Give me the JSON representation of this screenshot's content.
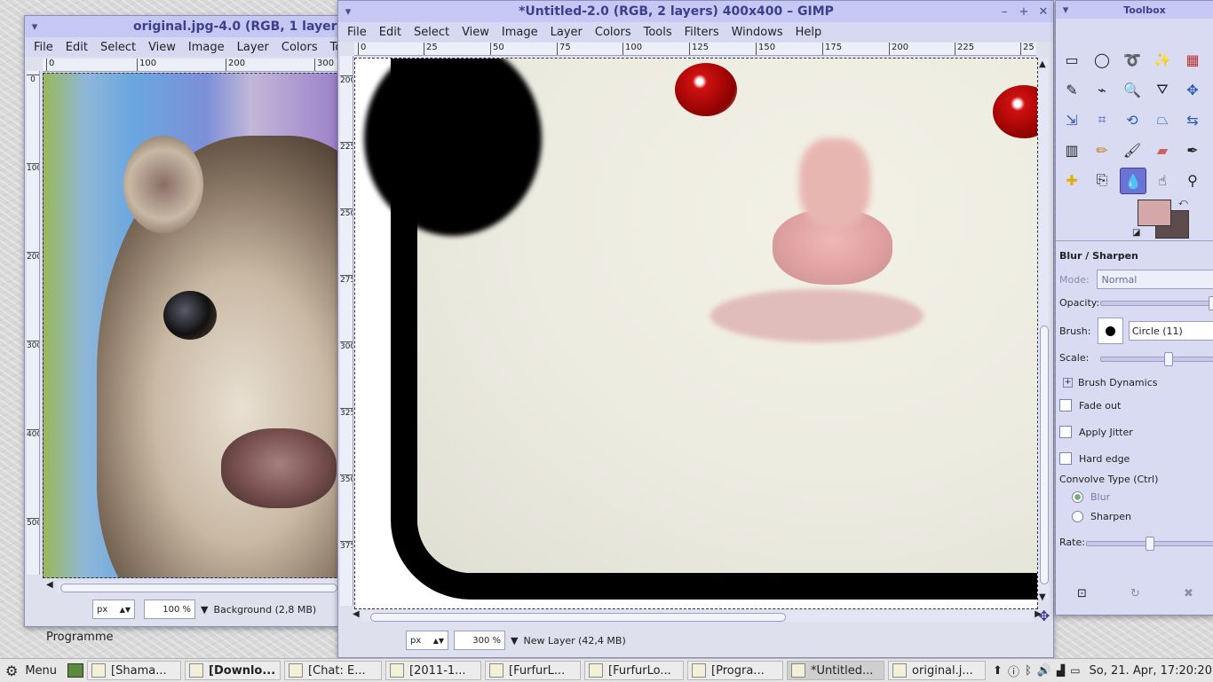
{
  "left_window": {
    "title": "original.jpg-4.0 (RGB, 1 layer",
    "menu": [
      "File",
      "Edit",
      "Select",
      "View",
      "Image",
      "Layer",
      "Colors",
      "Tools"
    ],
    "hruler": [
      "0",
      "100",
      "200",
      "300"
    ],
    "vruler": [
      "0",
      "100",
      "200",
      "300",
      "400",
      "500"
    ],
    "unit": "px",
    "zoom": "100 %",
    "status": "Background (2,8 MB)"
  },
  "main_window": {
    "title": "*Untitled-2.0 (RGB, 2 layers) 400x400 – GIMP",
    "menu": [
      "File",
      "Edit",
      "Select",
      "View",
      "Image",
      "Layer",
      "Colors",
      "Tools",
      "Filters",
      "Windows",
      "Help"
    ],
    "hruler": [
      "0",
      "25",
      "50",
      "75",
      "100",
      "125",
      "150",
      "175",
      "200",
      "225",
      "25"
    ],
    "vruler": [
      "200",
      "225",
      "250",
      "275",
      "300",
      "325",
      "350",
      "375"
    ],
    "unit": "px",
    "zoom": "300 %",
    "status": "New Layer (42,4 MB)"
  },
  "toolbox": {
    "title": "Toolbox",
    "tools": [
      "rect-select-icon",
      "ellipse-select-icon",
      "lasso-icon",
      "fuzzy-select-icon",
      "color-select-icon",
      "paths-icon",
      "color-picker-icon",
      "zoom-icon",
      "measure-icon",
      "move-icon",
      "align-icon",
      "crop-icon",
      "rotate-icon",
      "perspective-icon",
      "flip-icon",
      "blend-icon",
      "pencil-icon",
      "paintbrush-icon",
      "eraser-icon",
      "airbrush-icon",
      "heal-icon",
      "clone-icon",
      "blur-sharpen-icon",
      "smudge-icon",
      "dodge-burn-icon"
    ],
    "fg_color": "#d4a8a8",
    "bg_color": "#5e4c4c",
    "options_title": "Blur / Sharpen",
    "mode_label": "Mode:",
    "mode_value": "Normal",
    "opacity_label": "Opacity:",
    "opacity_value": 1.0,
    "brush_label": "Brush:",
    "brush_value": "Circle (11)",
    "scale_label": "Scale:",
    "scale_value": 0.6,
    "dynamics_label": "Brush Dynamics",
    "fade_label": "Fade out",
    "jitter_label": "Apply Jitter",
    "hard_label": "Hard edge",
    "convolve_label": "Convolve Type  (Ctrl)",
    "blur_label": "Blur",
    "sharpen_label": "Sharpen",
    "rate_label": "Rate:",
    "rate_value": 0.5
  },
  "desktop": {
    "label": "Programme"
  },
  "taskbar": {
    "menu_label": "Menu",
    "tasks": [
      "[Shama...",
      "[Downlo...",
      "[Chat: E...",
      "[2011-1...",
      "[FurfurL...",
      "[FurfurLo...",
      "[Progra...",
      "*Untitled...",
      "original.j..."
    ],
    "clock": "So, 21. Apr, 17:20:20"
  }
}
